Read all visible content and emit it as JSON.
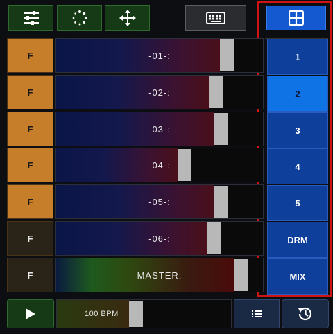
{
  "toolbar": {
    "mixer_settings_icon": "sliders-icon",
    "loading_icon": "spinner-icon",
    "move_icon": "move-arrows-icon",
    "keyboard_icon": "keyboard-icon",
    "grid_icon": "grid-icon"
  },
  "tracks": [
    {
      "f_label": "F",
      "name": "-01-:",
      "level": 0.85,
      "f_style": "orange"
    },
    {
      "f_label": "F",
      "name": "-02-:",
      "level": 0.79,
      "f_style": "orange"
    },
    {
      "f_label": "F",
      "name": "-03-:",
      "level": 0.82,
      "f_style": "orange"
    },
    {
      "f_label": "F",
      "name": "-04-:",
      "level": 0.63,
      "f_style": "orange"
    },
    {
      "f_label": "F",
      "name": "-05-:",
      "level": 0.82,
      "f_style": "orange"
    },
    {
      "f_label": "F",
      "name": "-06-:",
      "level": 0.78,
      "f_style": "dark"
    },
    {
      "f_label": "F",
      "name": "MASTER:",
      "level": 0.92,
      "f_style": "dark"
    }
  ],
  "pages": [
    {
      "label": "1",
      "active": false
    },
    {
      "label": "2",
      "active": true
    },
    {
      "label": "3",
      "active": false
    },
    {
      "label": "4",
      "active": false
    },
    {
      "label": "5",
      "active": false
    },
    {
      "label": "DRM",
      "active": false
    },
    {
      "label": "MIX",
      "active": false
    }
  ],
  "bottom": {
    "play_icon": "play-icon",
    "bpm_label": "100 BPM",
    "bpm_level": 0.45,
    "list_icon": "list-icon",
    "history_icon": "history-icon"
  },
  "colors": {
    "accent_green": "#163a16",
    "accent_blue": "#0f73e6",
    "highlight_red": "#d01414",
    "f_orange": "#c67e2a"
  }
}
